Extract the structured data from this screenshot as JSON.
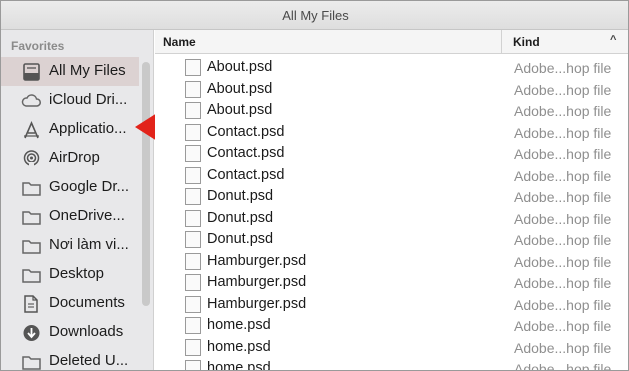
{
  "window": {
    "title": "All My Files"
  },
  "sidebar": {
    "section": "Favorites",
    "items": [
      {
        "label": "All My Files",
        "icon": "all-files-icon",
        "selected": true
      },
      {
        "label": "iCloud Dri...",
        "icon": "cloud-icon"
      },
      {
        "label": "Applicatio...",
        "icon": "applications-icon"
      },
      {
        "label": "AirDrop",
        "icon": "airdrop-icon"
      },
      {
        "label": "Google Dr...",
        "icon": "folder-icon"
      },
      {
        "label": "OneDrive...",
        "icon": "folder-icon"
      },
      {
        "label": "Nơi làm vi...",
        "icon": "folder-icon"
      },
      {
        "label": "Desktop",
        "icon": "folder-icon"
      },
      {
        "label": "Documents",
        "icon": "documents-icon"
      },
      {
        "label": "Downloads",
        "icon": "downloads-icon"
      },
      {
        "label": "Deleted U...",
        "icon": "folder-icon"
      }
    ]
  },
  "columns": {
    "name": "Name",
    "kind": "Kind",
    "sort_indicator": "^"
  },
  "files": [
    {
      "name": "About.psd",
      "kind": "Adobe...hop file",
      "thumb": "about"
    },
    {
      "name": "About.psd",
      "kind": "Adobe...hop file",
      "thumb": "about"
    },
    {
      "name": "About.psd",
      "kind": "Adobe...hop file",
      "thumb": "about"
    },
    {
      "name": "Contact.psd",
      "kind": "Adobe...hop file",
      "thumb": "contact"
    },
    {
      "name": "Contact.psd",
      "kind": "Adobe...hop file",
      "thumb": "contact"
    },
    {
      "name": "Contact.psd",
      "kind": "Adobe...hop file",
      "thumb": "contact"
    },
    {
      "name": "Donut.psd",
      "kind": "Adobe...hop file",
      "thumb": "donut"
    },
    {
      "name": "Donut.psd",
      "kind": "Adobe...hop file",
      "thumb": "donut"
    },
    {
      "name": "Donut.psd",
      "kind": "Adobe...hop file",
      "thumb": "donut"
    },
    {
      "name": "Hamburger.psd",
      "kind": "Adobe...hop file",
      "thumb": "burger"
    },
    {
      "name": "Hamburger.psd",
      "kind": "Adobe...hop file",
      "thumb": "burger"
    },
    {
      "name": "Hamburger.psd",
      "kind": "Adobe...hop file",
      "thumb": "burger"
    },
    {
      "name": "home.psd",
      "kind": "Adobe...hop file",
      "thumb": "home"
    },
    {
      "name": "home.psd",
      "kind": "Adobe...hop file",
      "thumb": "home"
    },
    {
      "name": "home.psd",
      "kind": "Adobe...hop file",
      "thumb": "home"
    }
  ],
  "colors": {
    "selection": "#dcd2d2",
    "arrow": "#e2231a",
    "sidebar_bg": "#e8e8ea"
  }
}
